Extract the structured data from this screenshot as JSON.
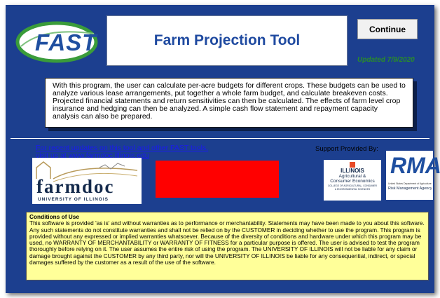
{
  "header": {
    "logo_text": "FAST",
    "title": "Farm Projection Tool",
    "continue_label": "Continue",
    "updated": "Updated 7/9/2020"
  },
  "description": "With this program, the user can calculate per-acre budgets for different crops. These budgets can be used to analyze various lease arrangements, put together a whole farm budget, and calculate breakeven costs. Projected financial statements and return sensitivities can then be calculated.  The effects of farm level crop insurance and hedging can then be analyzed.   A simple cash flow statement and repayment capacity analysis can also be prepared.",
  "links": {
    "line1": "For recent updates on this tool and other FAST tools,",
    "line2": "visit us at www.farmdoc.illinois.edu"
  },
  "farmdoc": {
    "name": "farmdoc",
    "sub": "UNIVERSITY OF ILLINOIS"
  },
  "support": {
    "label": "Support Provided By:",
    "illinois_name": "ILLINOIS",
    "illinois_dept1": "Agricultural &",
    "illinois_dept2": "Consumer Economics",
    "illinois_college1": "COLLEGE OF AGRICULTURAL, CONSUMER",
    "illinois_college2": "& ENVIRONMENTAL SCIENCES",
    "rma_logo": "RMA",
    "rma_line1": "United States Department of Agriculture",
    "rma_line2": "Risk Management Agency"
  },
  "conditions": {
    "title": "Conditions of Use",
    "text": "This software is provided 'as is' and without warranties as to performance or merchantability. Statements may have been made to you about this software. Any such statements do not constitute warranties and shall not be relied on by the CUSTOMER in deciding whether to use the program. This program is provided without any expressed or implied warranties whatsoever. Because of the diversity of conditions and hardware under which this program may be used, no WARRANTY OF MERCHANTABILITY or WARRANTY OF FITNESS for a particular purpose is offered.  The user is advised to test the program thoroughly before relying on it.  The user assumes the entire risk of using the program.  The UNIVERSITY OF ILLINOIS will not be liable for any claim or damage brought against the CUSTOMER by any third party, nor will the UNIVERSITY OF ILLINOIS be liable for any consequential, indirect, or special damages suffered by the customer as a result of the use of the software."
  },
  "colors": {
    "frame_bg": "#1c3f8f",
    "title_blue": "#1f4aa0",
    "updated_green": "#2a8c2a",
    "conditions_bg": "#ffff99",
    "red_placeholder": "#ff0000",
    "illinois_orange": "#e84a27",
    "illinois_navy": "#13294b"
  }
}
